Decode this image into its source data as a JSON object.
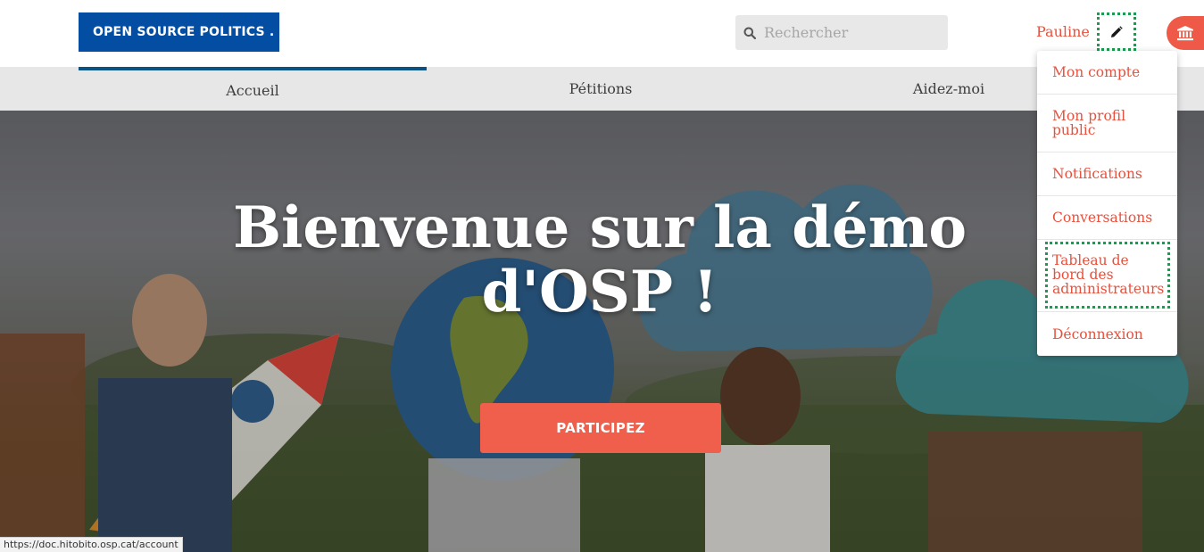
{
  "header": {
    "logo_text": "OPEN SOURCE POLITICS .",
    "search_placeholder": "Rechercher",
    "user_name": "Pauline",
    "icons": {
      "search": "search-icon",
      "edit": "pencil-icon",
      "admin": "bank-icon"
    }
  },
  "nav": {
    "items": [
      {
        "label": "Accueil",
        "active": true
      },
      {
        "label": "Pétitions",
        "active": false
      },
      {
        "label": "Aidez-moi",
        "active": false
      }
    ]
  },
  "hero": {
    "title": "Bienvenue sur la démo d'OSP !",
    "cta_label": "PARTICIPEZ"
  },
  "user_menu": {
    "items": [
      {
        "label": "Mon compte"
      },
      {
        "label": "Mon profil public"
      },
      {
        "label": "Notifications"
      },
      {
        "label": "Conversations"
      },
      {
        "label": "Tableau de bord des administrateurs",
        "focused": true
      },
      {
        "label": "Déconnexion"
      }
    ]
  },
  "status_bar": {
    "url": "https://doc.hitobito.osp.cat/account"
  },
  "colors": {
    "brand_blue": "#034ea2",
    "accent_red": "#ef5f4b",
    "focus_green": "#1f9a53"
  }
}
